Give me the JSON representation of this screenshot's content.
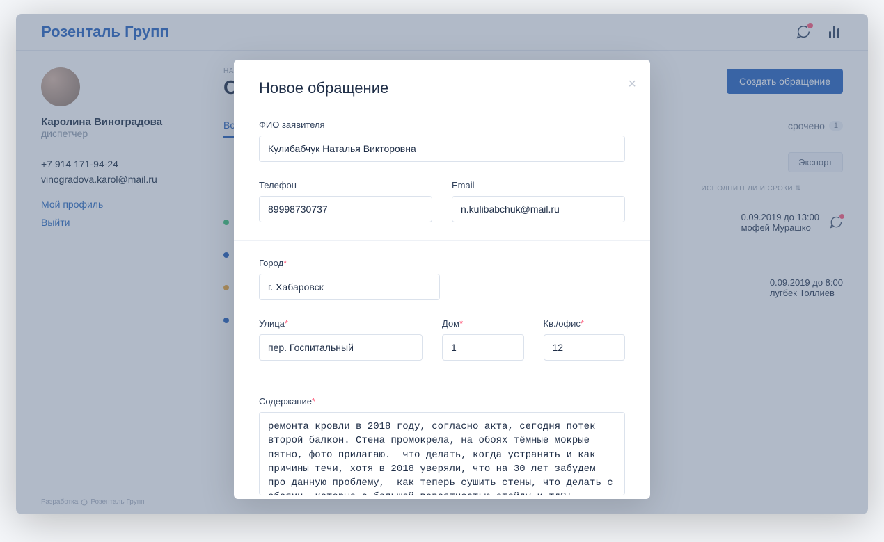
{
  "logo": "Розенталь Групп",
  "sidebar": {
    "user_name": "Каролина Виноградова",
    "role": "диспетчер",
    "phone": "+7 914 171-94-24",
    "email": "vinogradova.karol@mail.ru",
    "profile_link": "Мой профиль",
    "logout_link": "Выйти",
    "footer_dev": "Разработка",
    "footer_company": "Розенталь Групп"
  },
  "main": {
    "breadcrumb": "НА ГЛАВНУЮ",
    "page_title": "Обращения",
    "create_btn": "Создать обращение",
    "tabs": {
      "all": "Все",
      "overdue": "срочено",
      "overdue_count": "1"
    },
    "export_btn": "Экспорт",
    "col_executors": "ИСПОЛНИТЕЛИ И СРОКИ",
    "rows": [
      {
        "date": "0.09.2019 до 13:00",
        "name": "мофей Мурашко"
      },
      {
        "date": "0.09.2019 до 8:00",
        "name": "лугбек Толлиев"
      }
    ]
  },
  "modal": {
    "title": "Новое обращение",
    "labels": {
      "fio": "ФИО заявителя",
      "phone": "Телефон",
      "email": "Email",
      "city": "Город",
      "street": "Улица",
      "house": "Дом",
      "apt": "Кв./офис",
      "content": "Содержание"
    },
    "values": {
      "fio": "Кулибабчук Наталья Викторовна",
      "phone": "89998730737",
      "email": "n.kulibabchuk@mail.ru",
      "city": "г. Хабаровск",
      "street": "пер. Госпитальный",
      "house": "1",
      "apt": "12",
      "content": "ремонта кровли в 2018 году, согласно акта, сегодня потек второй балкон. Стена промокрела, на обоях тёмные мокрые пятно, фото прилагаю.  что делать, когда устранять и как причины течи, хотя в 2018 уверяли, что на 30 лет забудем про данную проблему,  как теперь сушить стены, что делать с обоями, которые с большой вероятностью отойду и тд?!"
    }
  }
}
